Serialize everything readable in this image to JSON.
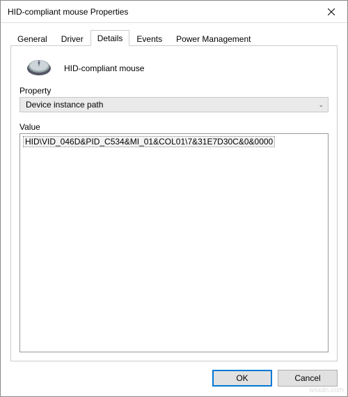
{
  "window": {
    "title": "HID-compliant mouse Properties"
  },
  "tabs": {
    "general": "General",
    "driver": "Driver",
    "details": "Details",
    "events": "Events",
    "power": "Power Management",
    "active": "details"
  },
  "details": {
    "device_name": "HID-compliant mouse",
    "property_label": "Property",
    "property_selected": "Device instance path",
    "value_label": "Value",
    "value_item": "HID\\VID_046D&PID_C534&MI_01&COL01\\7&31E7D30C&0&0000"
  },
  "buttons": {
    "ok": "OK",
    "cancel": "Cancel"
  },
  "watermark": "wsxdn.com"
}
